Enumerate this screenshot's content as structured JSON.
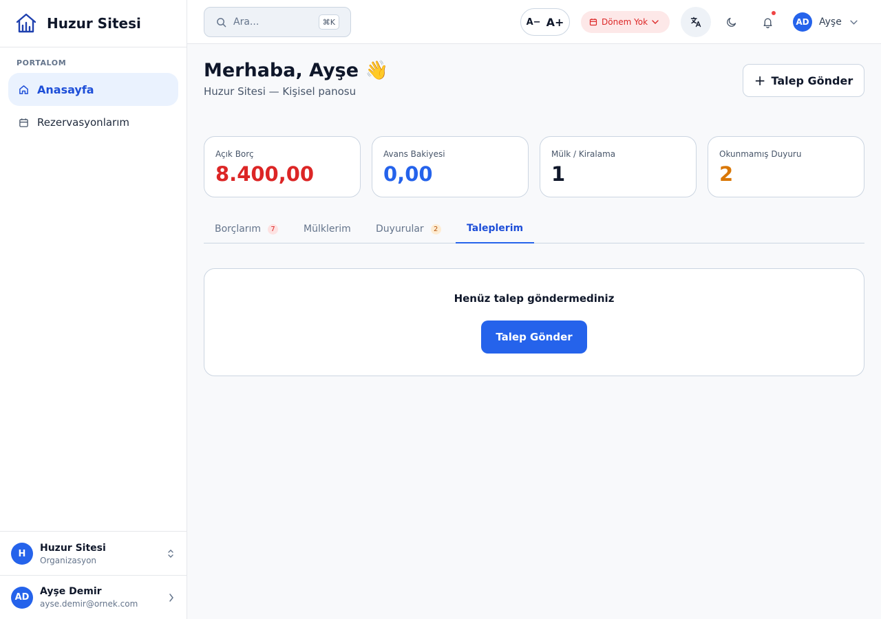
{
  "brand": {
    "name": "Huzur Sitesi"
  },
  "sidebar": {
    "section": "PORTALOM",
    "items": [
      {
        "label": "Anasayfa",
        "icon": "home-icon",
        "active": true
      },
      {
        "label": "Rezervasyonlarım",
        "icon": "calendar-icon",
        "active": false
      }
    ],
    "org": {
      "initial": "H",
      "name": "Huzur Sitesi",
      "type": "Organizasyon"
    },
    "user": {
      "initials": "AD",
      "name": "Ayşe Demir",
      "email": "ayse.demir@ornek.com"
    }
  },
  "topbar": {
    "search_placeholder": "Ara...",
    "shortcut": "⌘K",
    "font_decrease": "A−",
    "font_increase": "A+",
    "period_label": "Dönem Yok",
    "profile_initials": "AD",
    "profile_name": "Ayşe"
  },
  "header": {
    "greeting": "Merhaba, Ayşe 👋",
    "subtitle": "Huzur Sitesi — Kişisel panosu",
    "action_label": "Talep Gönder"
  },
  "stats": [
    {
      "label": "Açık Borç",
      "value": "8.400,00",
      "color": "#dc2626"
    },
    {
      "label": "Avans Bakiyesi",
      "value": "0,00",
      "color": "#2563eb"
    },
    {
      "label": "Mülk / Kiralama",
      "value": "1",
      "color": "#0f172a"
    },
    {
      "label": "Okunmamış Duyuru",
      "value": "2",
      "color": "#d97706"
    }
  ],
  "tabs": [
    {
      "label": "Borçlarım",
      "badge": "7"
    },
    {
      "label": "Mülklerim",
      "badge": ""
    },
    {
      "label": "Duyurular",
      "badge": "2"
    },
    {
      "label": "Taleplerim",
      "badge": "",
      "active": true
    }
  ],
  "empty_state": {
    "message": "Henüz talep göndermediniz",
    "button_label": "Talep Gönder"
  },
  "colors": {
    "accent": "#2563eb",
    "danger": "#dc2626",
    "warning": "#d97706"
  }
}
